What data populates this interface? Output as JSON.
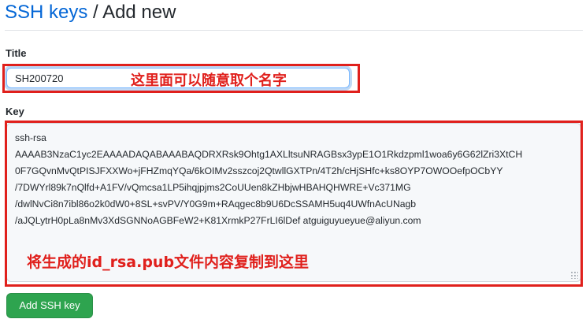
{
  "header": {
    "breadcrumb_link": "SSH keys",
    "separator": "/",
    "current": "Add new"
  },
  "form": {
    "title_label": "Title",
    "title_value": "SH200720",
    "key_label": "Key",
    "key_lines": [
      "ssh-rsa",
      "AAAAB3NzaC1yc2EAAAADAQABAAABAQDRXRsk9Ohtg1AXLltsuNRAGBsx3ypE1O1Rkdzpml1woa6y6G62lZri3XtCH",
      "0F7GQvnMvQtPISJFXXWo+jFHZmqYQa/6kOIMv2sszcoj2QtwllGXTPn/4T2h/cHjSHfc+ks8OYP7OWOOefpOCbYY",
      "/7DWYrl89k7nQlfd+A1FV/vQmcsa1LP5ihqjpjms2CoUUen8kZHbjwHBAHQHWRE+Vc371MG",
      "/dwlNvCi8n7ibl86o2k0dW0+8SL+svPV/Y0G9m+RAqgec8b9U6DcSSAMH5uq4UWfnAcUNagb",
      "/aJQLytrH0pLa8nMv3XdSGNNoAGBFeW2+K81XrmkP27FrLI6lDef atguiguyueyue@aliyun.com"
    ],
    "add_button_label": "Add SSH key"
  },
  "annotations": {
    "title_note": "这里面可以随意取个名字",
    "key_note": "将生成的id_rsa.pub文件内容复制到这里",
    "highlight_color": "#e0201c"
  },
  "colors": {
    "link": "#0366d6",
    "button_bg": "#2ea44f",
    "focus_border": "#79b8ff"
  }
}
